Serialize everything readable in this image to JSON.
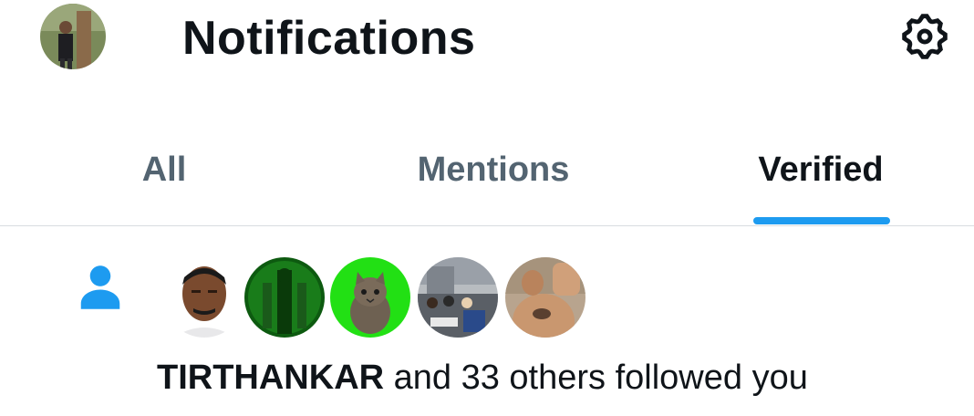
{
  "header": {
    "title": "Notifications",
    "profile_avatar": "profile-avatar",
    "settings_icon": "gear-icon"
  },
  "tabs": [
    {
      "label": "All",
      "active": false
    },
    {
      "label": "Mentions",
      "active": false
    },
    {
      "label": "Verified",
      "active": true
    }
  ],
  "colors": {
    "accent": "#1d9bf0",
    "text_primary": "#0f1419",
    "text_secondary": "#536471"
  },
  "notification": {
    "type_icon": "person-icon",
    "avatars": [
      "avatar-1",
      "avatar-2",
      "avatar-3",
      "avatar-4",
      "avatar-5"
    ],
    "actor": "TIRTHANKAR",
    "rest": " and 33 others followed you"
  }
}
